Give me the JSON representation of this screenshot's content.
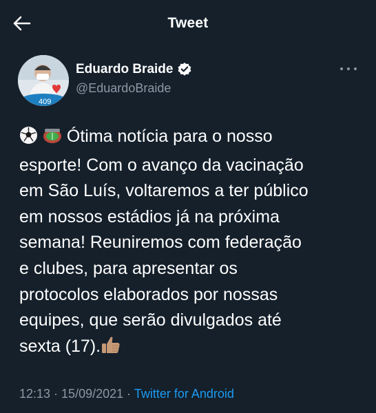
{
  "header": {
    "title": "Tweet",
    "back_icon": "arrow-left-icon"
  },
  "author": {
    "display_name": "Eduardo Braide",
    "handle": "@EduardoBraide",
    "verified": true,
    "avatar_badge": "409",
    "more_icon": "more-horizontal-icon"
  },
  "tweet": {
    "icons_leading": [
      "soccer-ball-icon",
      "stadium-icon"
    ],
    "lines": [
      " Ótima notícia para o nosso",
      "esporte! Com o avanço da vacinação",
      "em São Luís, voltaremos a ter público",
      "em nossos estádios já na próxima",
      "semana! Reuniremos com federação",
      "e clubes, para apresentar os",
      "protocolos elaborados por nossas",
      "equipes, que serão divulgados até",
      "sexta (17)."
    ],
    "icon_trailing": "thumbs-up-icon"
  },
  "meta": {
    "time": "12:13",
    "separator": " · ",
    "date": "15/09/2021",
    "source": "Twitter for Android"
  },
  "colors": {
    "background": "#15202b",
    "text": "#ffffff",
    "secondary": "#8b98a5",
    "accent": "#1d9bf0"
  }
}
